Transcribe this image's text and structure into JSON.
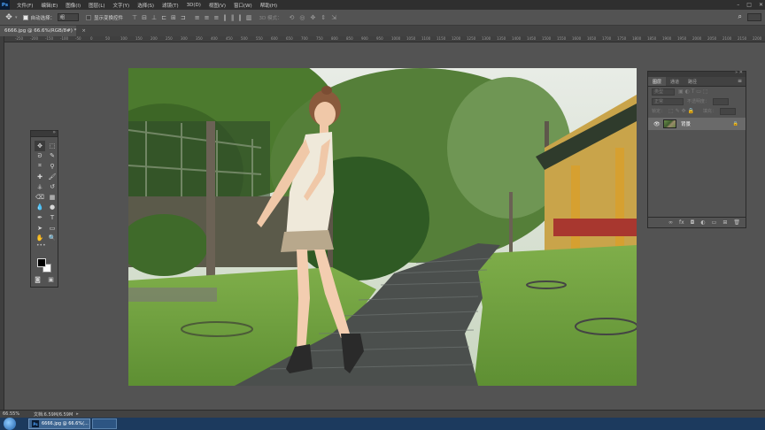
{
  "app": {
    "logo": "Ps"
  },
  "menu": [
    "文件(F)",
    "编辑(E)",
    "图像(I)",
    "图层(L)",
    "文字(Y)",
    "选择(S)",
    "滤镜(T)",
    "3D(D)",
    "视图(V)",
    "窗口(W)",
    "帮助(H)"
  ],
  "options": {
    "auto_select_label": "自动选择：",
    "auto_select_value": "组",
    "show_transform_label": "显示变换控件",
    "mode_3d_label": "3D 模式："
  },
  "document": {
    "tab_title": "6666.jpg @ 66.6%(RGB/8#) *",
    "close": "×"
  },
  "ruler": {
    "marks": [
      "-250",
      "-200",
      "-150",
      "-100",
      "-50",
      "0",
      "50",
      "100",
      "150",
      "200",
      "250",
      "300",
      "350",
      "400",
      "450",
      "500",
      "550",
      "600",
      "650",
      "700",
      "750",
      "800",
      "850",
      "900",
      "950",
      "1000",
      "1050",
      "1100",
      "1150",
      "1200",
      "1250",
      "1300",
      "1350",
      "1400",
      "1450",
      "1500",
      "1550",
      "1600",
      "1650",
      "1700",
      "1750",
      "1800",
      "1850",
      "1900",
      "1950",
      "2000",
      "2050",
      "2100",
      "2150",
      "2200",
      "2250"
    ]
  },
  "tools": {
    "more": "•••"
  },
  "layers_panel": {
    "tabs": [
      "图层",
      "通道",
      "路径"
    ],
    "kind_filter": "类型",
    "blend_mode": "正常",
    "opacity_label": "不透明度：",
    "lock_label": "锁定：",
    "fill_label": "填充：",
    "layer_name": "背景"
  },
  "status": {
    "zoom": "66.55%",
    "doc_info": "文档:6.59M/6.59M"
  },
  "taskbar": {
    "task_label": "6666.jpg @ 66.6%(..."
  },
  "colors": {
    "menu_bg": "#2f2f2f",
    "workspace": "#535353",
    "taskbar": "#1c3a5e",
    "foreground_color": "#000000",
    "background_color": "#ffffff"
  }
}
